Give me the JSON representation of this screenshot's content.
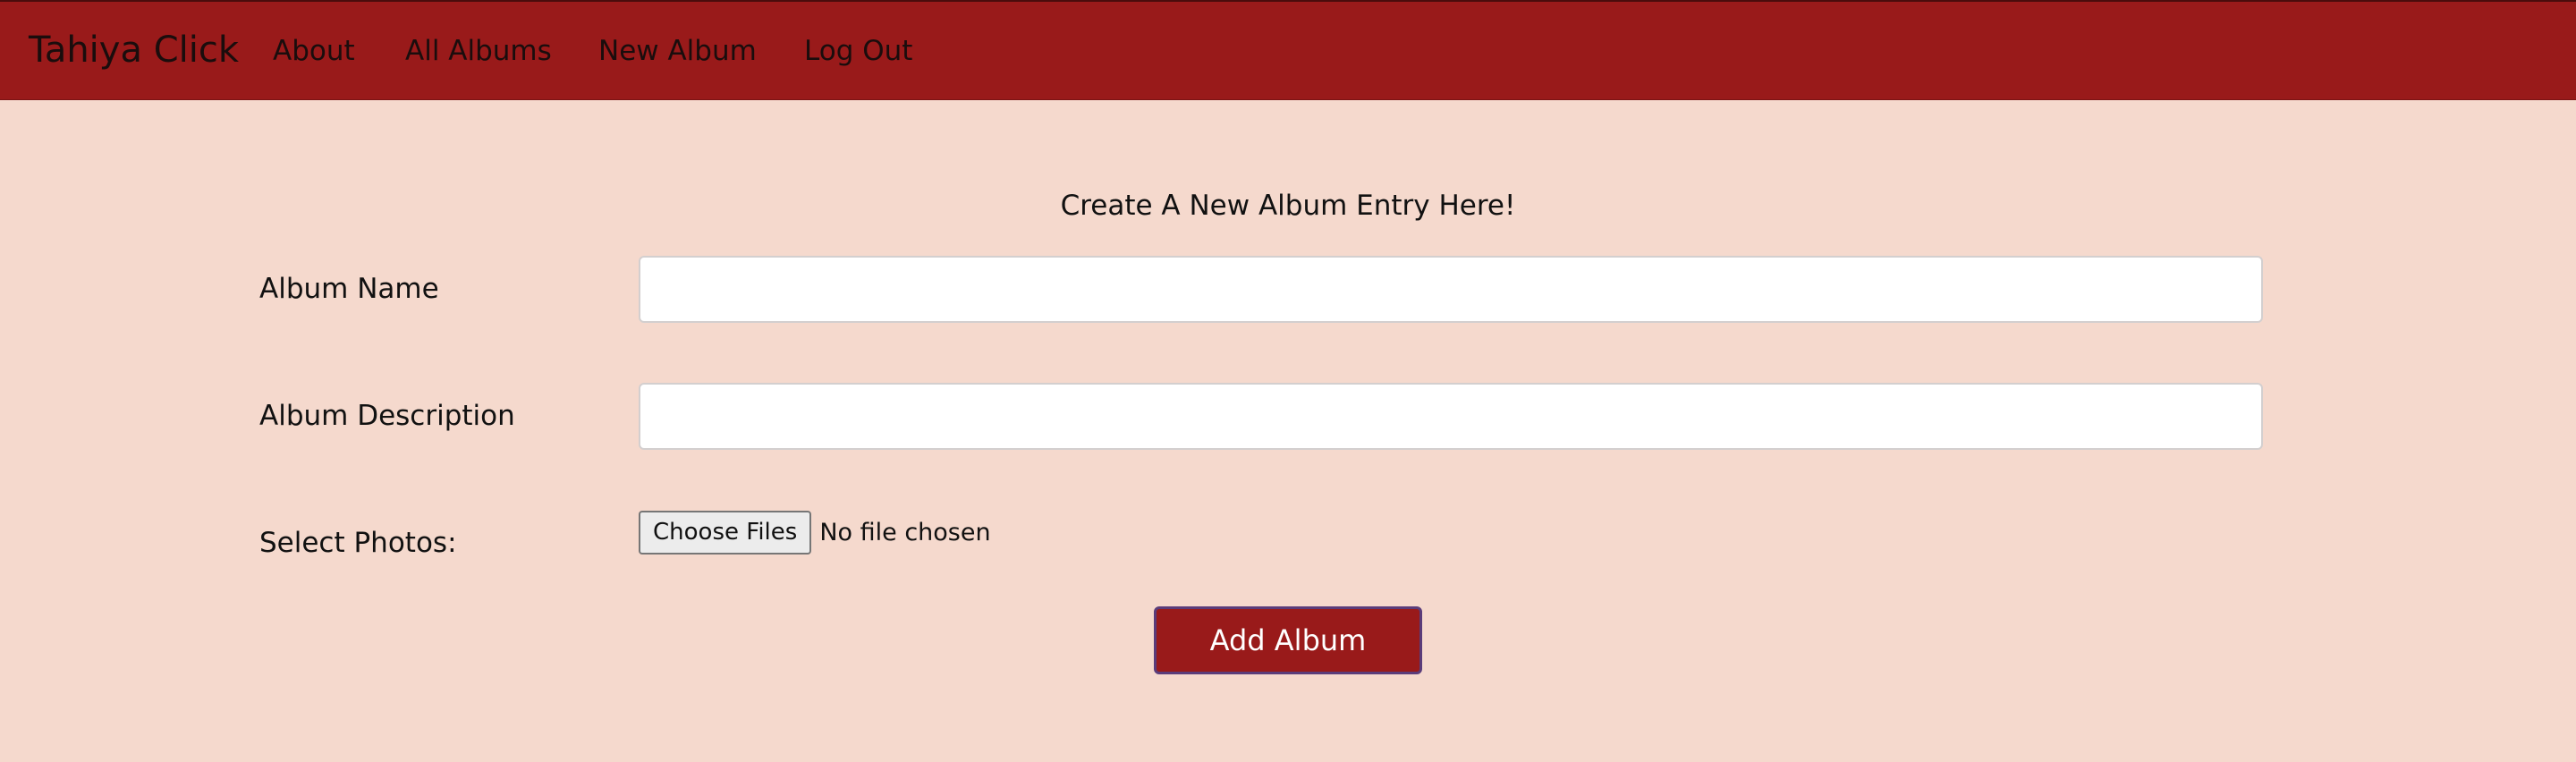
{
  "navbar": {
    "brand": "Tahiya Click",
    "links": [
      {
        "label": "About"
      },
      {
        "label": "All Albums"
      },
      {
        "label": "New Album"
      },
      {
        "label": "Log Out"
      }
    ]
  },
  "form": {
    "heading": "Create A New Album Entry Here!",
    "album_name": {
      "label": "Album Name",
      "value": "",
      "placeholder": ""
    },
    "album_description": {
      "label": "Album Description",
      "value": "",
      "placeholder": ""
    },
    "photos": {
      "label": "Select Photos:",
      "button_label": "Choose Files",
      "status": "No file chosen"
    },
    "submit_label": "Add Album"
  },
  "colors": {
    "navbar_bg": "#991a1a",
    "page_bg": "#f5d9cd",
    "button_bg": "#991a1a",
    "button_text": "#ffffff"
  }
}
